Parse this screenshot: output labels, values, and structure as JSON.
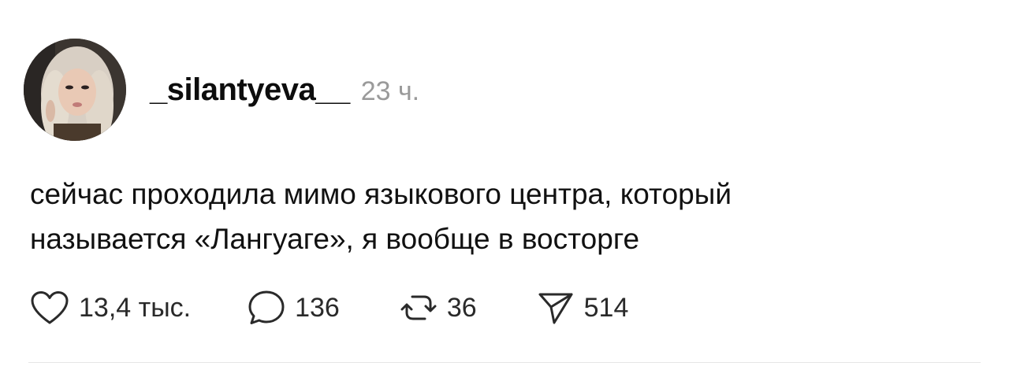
{
  "post": {
    "username": "_silantyeva__",
    "time": "23 ч.",
    "text_line1": "сейчас проходила мимо языкового центра, который",
    "text_line2": "называется «Лангуаге», я вообще в восторге",
    "actions": {
      "likes": {
        "icon": "heart-icon",
        "count": "13,4 тыс."
      },
      "replies": {
        "icon": "comment-icon",
        "count": "136"
      },
      "reposts": {
        "icon": "repost-icon",
        "count": "36"
      },
      "shares": {
        "icon": "send-icon",
        "count": "514"
      }
    }
  },
  "colors": {
    "text": "#111111",
    "muted": "#9a9a9a",
    "divider": "#e6e6e6"
  }
}
